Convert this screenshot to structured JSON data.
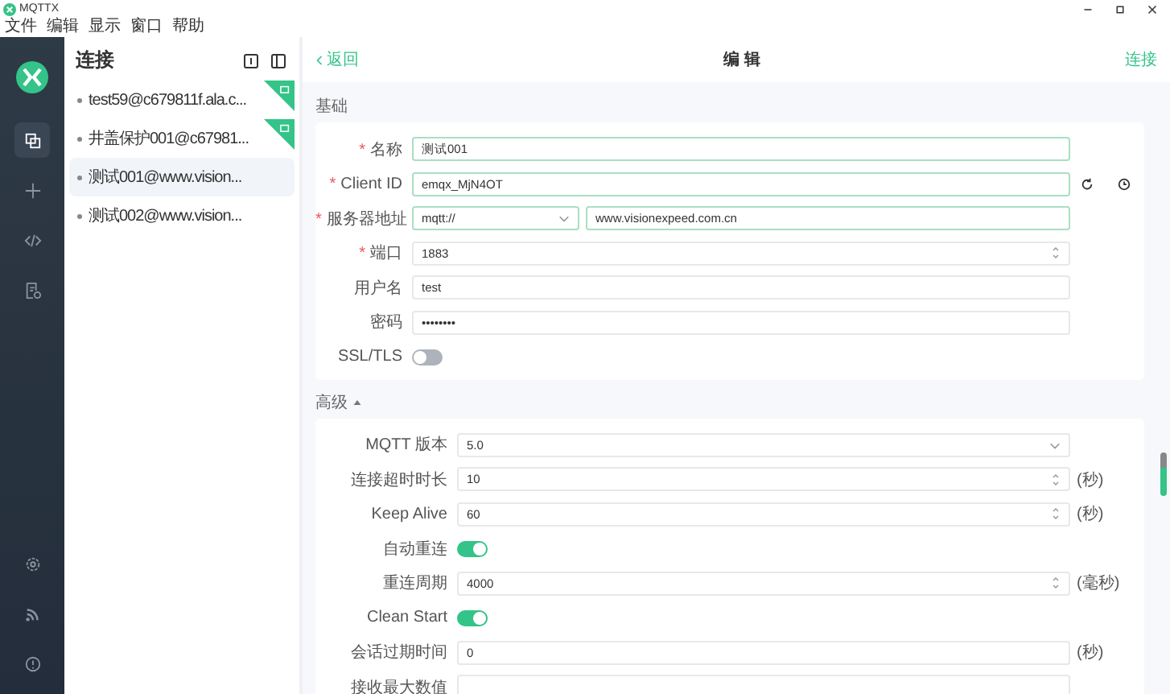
{
  "window": {
    "title": "MQTTX"
  },
  "menu": [
    "文件",
    "编辑",
    "显示",
    "窗口",
    "帮助"
  ],
  "rail": [
    {
      "kind": "connections",
      "selected": true
    },
    {
      "kind": "new",
      "selected": false
    },
    {
      "kind": "script",
      "selected": false
    },
    {
      "kind": "log",
      "selected": false
    }
  ],
  "rail_bottom": [
    {
      "kind": "settings",
      "selected": false
    },
    {
      "kind": "feedback",
      "selected": false
    },
    {
      "kind": "about",
      "selected": false
    }
  ],
  "connections": {
    "title": "连接",
    "items": [
      {
        "label": "test59@c679811f.ala.c...",
        "ssl": true,
        "selected": false
      },
      {
        "label": "井盖保护001@c67981...",
        "ssl": true,
        "selected": false
      },
      {
        "label": "测试001@www.vision...",
        "ssl": false,
        "selected": true
      },
      {
        "label": "测试002@www.vision...",
        "ssl": false,
        "selected": false
      }
    ]
  },
  "header": {
    "back": "返回",
    "title": "编 辑",
    "action": "连接"
  },
  "basic": {
    "title": "基础",
    "fields": [
      {
        "kind": "text",
        "mark": "*",
        "label": "名称",
        "validated": true,
        "value": "测试001"
      },
      {
        "kind": "client-id",
        "mark": "*",
        "label": "Client ID",
        "validated": true,
        "value": "emqx_MjN4OT"
      },
      {
        "kind": "server",
        "mark": "*",
        "label": "服务器地址",
        "validated": true,
        "protocol": "mqtt://",
        "value": "www.visionexpeed.com.cn"
      },
      {
        "kind": "number",
        "mark": "*",
        "label": "端口",
        "validated": false,
        "value": "1883"
      },
      {
        "kind": "text",
        "label": "用户名",
        "validated": false,
        "value": "test"
      },
      {
        "kind": "text",
        "label": "密码",
        "validated": false,
        "value": "••••••••"
      },
      {
        "kind": "switch",
        "label": "SSL/TLS",
        "on": false
      }
    ]
  },
  "advanced": {
    "title": "高级",
    "expanded": true,
    "fields": [
      {
        "kind": "select",
        "label": "MQTT 版本",
        "value": "5.0"
      },
      {
        "kind": "number",
        "label": "连接超时时长",
        "value": "10",
        "unit": "(秒)"
      },
      {
        "kind": "number",
        "label": "Keep Alive",
        "value": "60",
        "unit": "(秒)"
      },
      {
        "kind": "switch",
        "label": "自动重连",
        "on": true
      },
      {
        "kind": "number",
        "label": "重连周期",
        "value": "4000",
        "unit": "(毫秒)"
      },
      {
        "kind": "switch",
        "label": "Clean Start",
        "on": true
      },
      {
        "kind": "text",
        "label": "会话过期时间",
        "value": "0",
        "unit": "(秒)"
      },
      {
        "kind": "text",
        "label": "接收最大数值"
      }
    ]
  }
}
